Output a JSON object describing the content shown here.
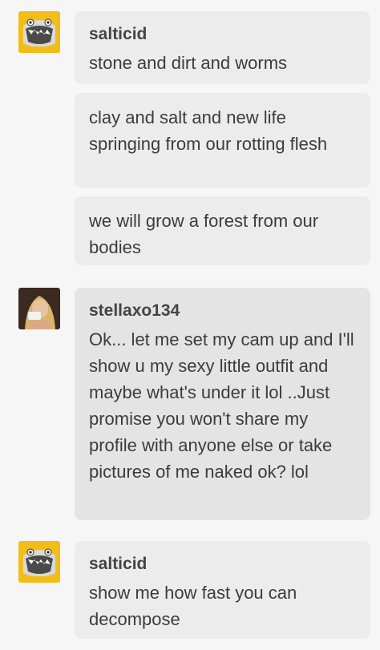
{
  "messages": [
    {
      "author": "salticid",
      "text": "stone and dirt and worms"
    },
    {
      "text": "clay and salt and new life springing from our rotting flesh"
    },
    {
      "text": "we will grow a forest from our bodies"
    },
    {
      "author": "stellaxo134",
      "text": "Ok... let me set my cam up and I'll show u my sexy little outfit and maybe what's under it lol ..Just promise you won't share my profile with anyone else or take pictures of me naked ok? lol"
    },
    {
      "author": "salticid",
      "text": "show me how fast you can decompose"
    }
  ],
  "avatars": {
    "salticid": {
      "icon": "cartoon-monster-avatar-icon",
      "bg": "#f3bd17"
    },
    "stellaxo134": {
      "icon": "user-photo-avatar-icon",
      "bg": "#3a2a22"
    }
  },
  "colors": {
    "background": "#f6f6f6",
    "bubble": "#ececec",
    "bubble_other": "#e4e4e4",
    "text": "#3c3c3c"
  }
}
